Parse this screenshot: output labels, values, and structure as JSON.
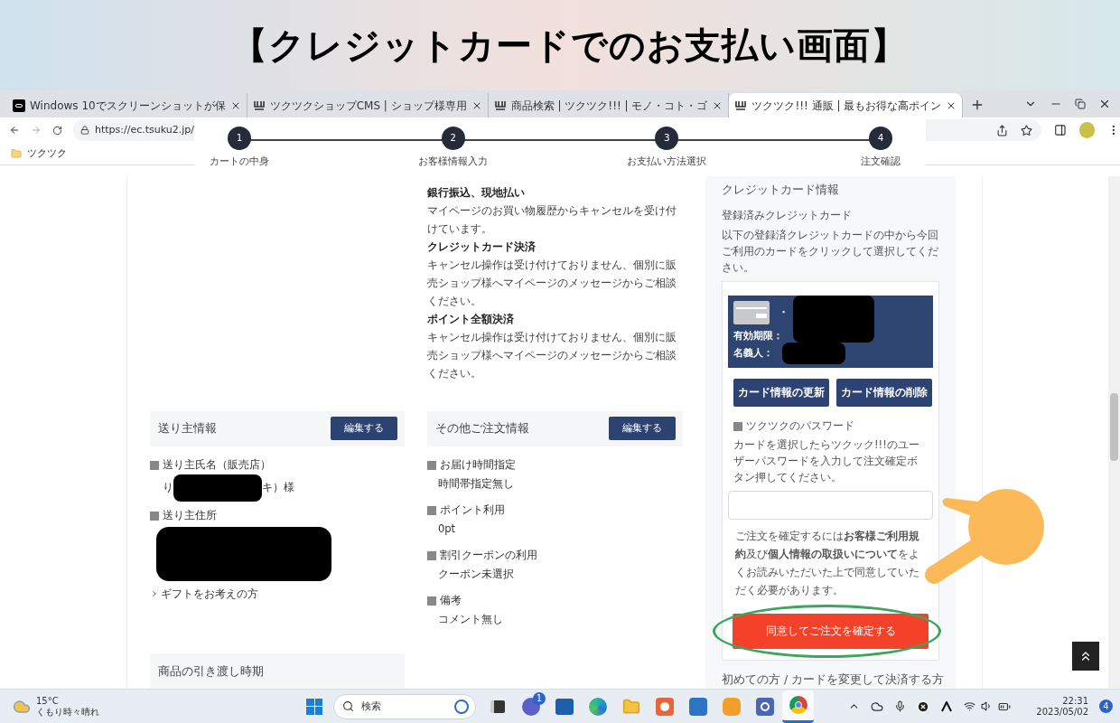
{
  "banner": {
    "title": "【クレジットカードでのお支払い画面】"
  },
  "browser": {
    "tabs": [
      {
        "title": "Windows 10でスクリーンショットが保",
        "kind": "dark",
        "selected": false
      },
      {
        "title": "ツクツクショップCMS | ショップ様専用",
        "kind": "shop",
        "selected": false
      },
      {
        "title": "商品検索 | ツクツク!!! | モノ・コト・ゴ",
        "kind": "shop",
        "selected": false
      },
      {
        "title": "ツクツク!!! 通販 | 最もお得な高ポイン",
        "kind": "shop",
        "selected": true
      }
    ],
    "url": "https://ec.tsuku2.jp/",
    "bookmarks": [
      {
        "label": "ツクツク"
      }
    ]
  },
  "steps": [
    {
      "number": "1",
      "label": "カートの中身"
    },
    {
      "number": "2",
      "label": "お客様情報入力"
    },
    {
      "number": "3",
      "label": "お支払い方法選択"
    },
    {
      "number": "4",
      "label": "注文確認"
    }
  ],
  "cancel_policy": [
    {
      "heading": "銀行振込、現地払い",
      "body": "マイページのお買い物履歴からキャンセルを受け付けています。"
    },
    {
      "heading": "クレジットカード決済",
      "body": "キャンセル操作は受け付けておりません、個別に販売ショップ様へマイページのメッセージからご相談ください。"
    },
    {
      "heading": "ポイント全額決済",
      "body": "キャンセル操作は受け付けておりません、個別に販売ショップ様へマイページのメッセージからご相談ください。"
    }
  ],
  "sender": {
    "title": "送り主情報",
    "edit_button": "編集する",
    "fields": [
      {
        "kind": "name",
        "label": "送り主氏名（販売店）",
        "value_start": "り",
        "value_end": "キ）様"
      },
      {
        "kind": "hidden",
        "label": "送り主住所"
      }
    ],
    "gift_link": "ギフトをお考えの方"
  },
  "delivery": {
    "title": "商品の引き渡し時期"
  },
  "other": {
    "title": "その他ご注文情報",
    "edit_button": "編集する",
    "fields": [
      {
        "label": "お届け時間指定",
        "value": "時間帯指定無し"
      },
      {
        "label": "ポイント利用",
        "value": "0pt"
      },
      {
        "label": "割引クーポンの利用",
        "value": "クーポン未選択"
      },
      {
        "label": "備考",
        "value": "コメント無し"
      }
    ]
  },
  "credit": {
    "title": "クレジットカード情報",
    "registered_title": "登録済みクレジットカード",
    "registered_note": "以下の登録済クレジットカードの中から今回ご利用のカードをクリックして選択してください。",
    "card": {
      "number_prefix": "・",
      "expiry_label": "有効期限：",
      "holder_label": "名義人："
    },
    "card_buttons": [
      "カード情報の更新",
      "カード情報の削除"
    ],
    "password_label": "ツクツクのパスワード",
    "password_note": "カードを選択したらツクック!!!のユーザーパスワードを入力して注文確定ボタン押してください。",
    "agreement": "ご注文を確定するには**お客様ご利用規約**及び**個人情報の取扱いについて**をよくお読みいただいた上で同意していただく必要があります。",
    "confirm_button": "同意してご注文を確定する",
    "next_section": "初めての方 / カードを変更して決済する方"
  },
  "taskbar": {
    "weather": {
      "temperature": "15°C",
      "description": "くもり時々晴れ"
    },
    "search": {
      "placeholder": "検索"
    },
    "apps": [
      {
        "kind": "taskview",
        "active": false
      },
      {
        "kind": "chat",
        "active": false,
        "badge": "1"
      },
      {
        "kind": "store",
        "active": false
      },
      {
        "kind": "edge",
        "active": false
      },
      {
        "kind": "folder",
        "active": false
      },
      {
        "kind": "mail",
        "active": false
      },
      {
        "kind": "photo",
        "active": false
      },
      {
        "kind": "owl",
        "active": false
      },
      {
        "kind": "contact",
        "active": false
      },
      {
        "kind": "chrome",
        "active": true
      }
    ],
    "time": "22:31",
    "date": "2023/05/02",
    "notifications": "4"
  }
}
